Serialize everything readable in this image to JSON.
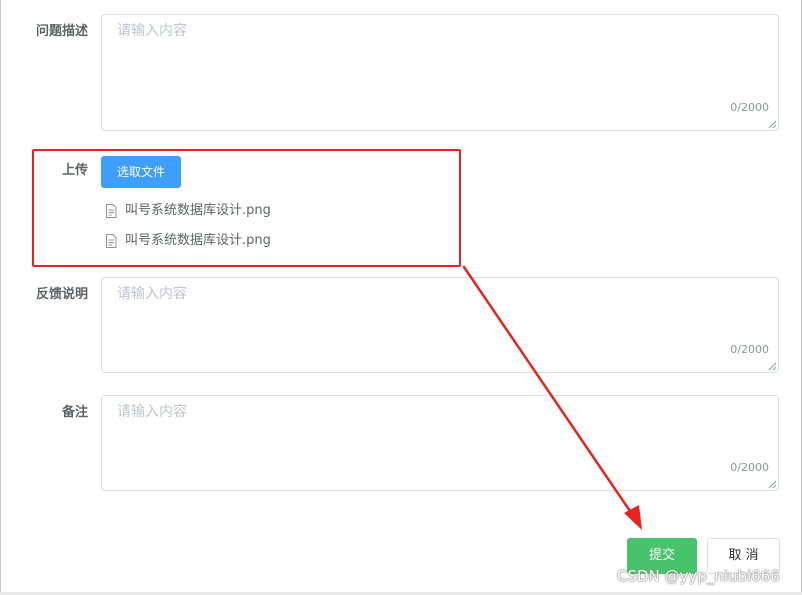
{
  "form": {
    "description": {
      "label": "问题描述",
      "placeholder": "请输入内容",
      "counter": "0/2000"
    },
    "upload": {
      "label": "上传",
      "button_label": "选取文件",
      "files": [
        {
          "name": "叫号系统数据库设计.png",
          "icon": "document-icon"
        },
        {
          "name": "叫号系统数据库设计.png",
          "icon": "document-icon"
        }
      ]
    },
    "feedback": {
      "label": "反馈说明",
      "placeholder": "请输入内容",
      "counter": "0/2000"
    },
    "remark": {
      "label": "备注",
      "placeholder": "请输入内容",
      "counter": "0/2000"
    }
  },
  "actions": {
    "submit_label": "提交",
    "cancel_label": "取消"
  },
  "annotation": {
    "highlight_color": "#e8231f",
    "arrow_color": "#e8231f"
  },
  "watermark": {
    "text": "CSDN @yyp_niubi666"
  },
  "colors": {
    "primary": "#409eff",
    "success": "#47c46b",
    "border": "#dcdfe6",
    "placeholder": "#c0c4cc"
  }
}
